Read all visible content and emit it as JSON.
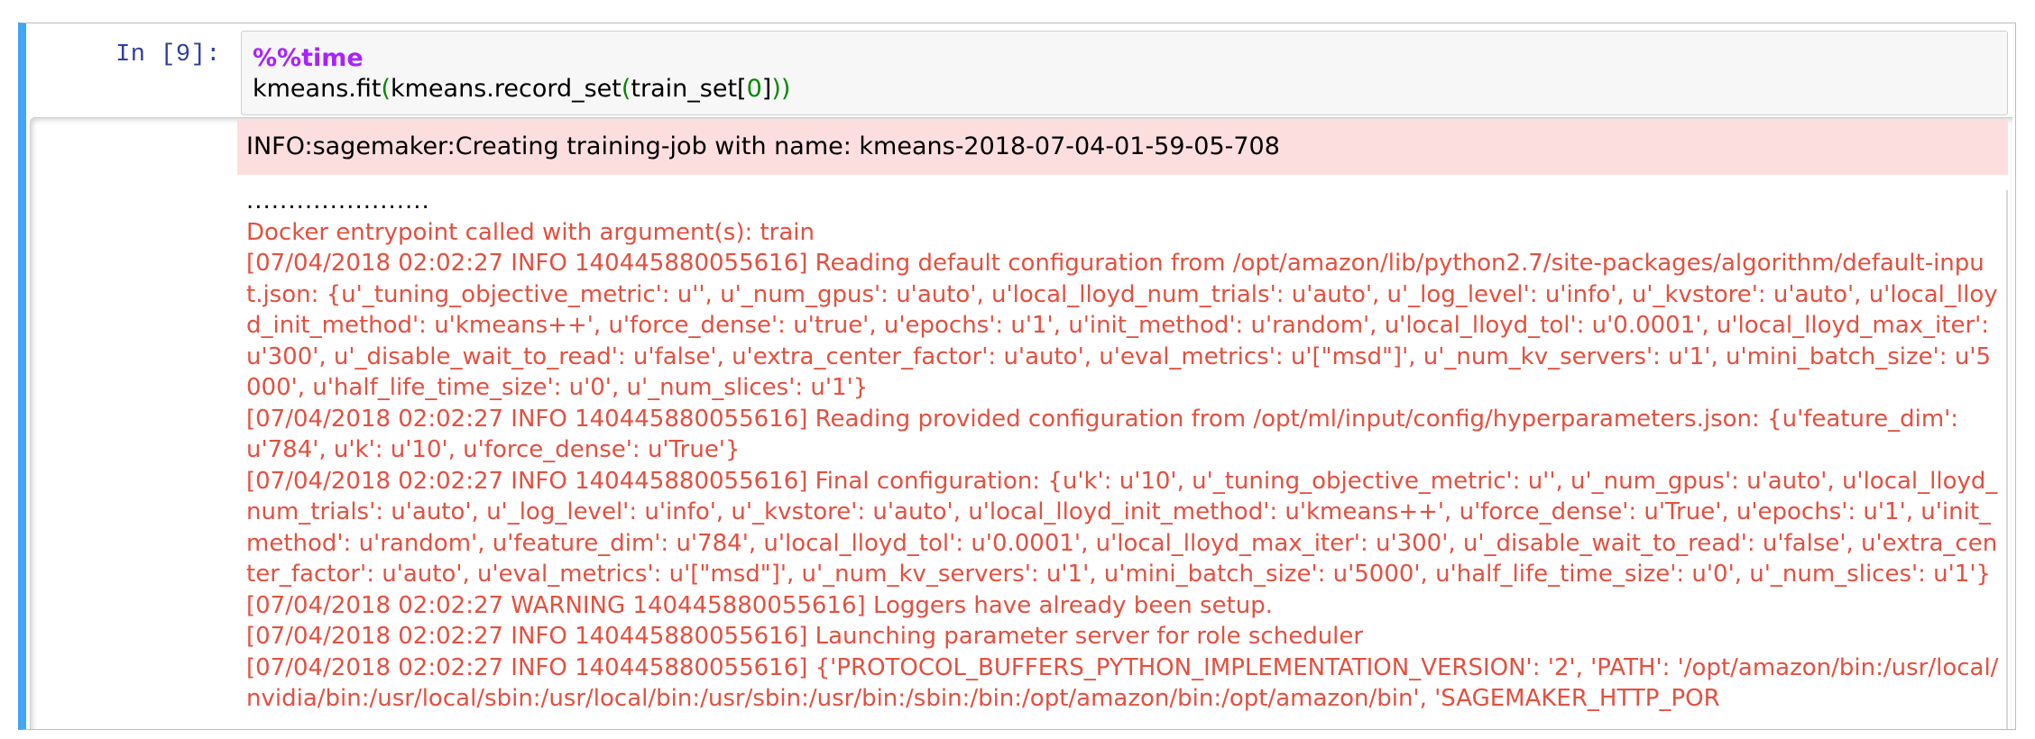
{
  "cell": {
    "prompt": "In [9]:",
    "code": {
      "magic": "%%time",
      "line2_pre": "kmeans.fit",
      "line2_open1": "(",
      "line2_mid": "kmeans.record_set",
      "line2_open2": "(",
      "line2_arg": "train_set[",
      "line2_num": "0",
      "line2_close_bracket": "]",
      "line2_close": "))"
    }
  },
  "output": {
    "info_message": "INFO:sagemaker:Creating training-job with name: kmeans-2018-07-04-01-59-05-708",
    "progress_dots": "......................",
    "log_lines": [
      "Docker entrypoint called with argument(s): train",
      "[07/04/2018 02:02:27 INFO 140445880055616] Reading default configuration from /opt/amazon/lib/python2.7/site-packages/algorithm/default-input.json: {u'_tuning_objective_metric': u'', u'_num_gpus': u'auto', u'local_lloyd_num_trials': u'auto', u'_log_level': u'info', u'_kvstore': u'auto', u'local_lloyd_init_method': u'kmeans++', u'force_dense': u'true', u'epochs': u'1', u'init_method': u'random', u'local_lloyd_tol': u'0.0001', u'local_lloyd_max_iter': u'300', u'_disable_wait_to_read': u'false', u'extra_center_factor': u'auto', u'eval_metrics': u'[\"msd\"]', u'_num_kv_servers': u'1', u'mini_batch_size': u'5000', u'half_life_time_size': u'0', u'_num_slices': u'1'}",
      "[07/04/2018 02:02:27 INFO 140445880055616] Reading provided configuration from /opt/ml/input/config/hyperparameters.json: {u'feature_dim': u'784', u'k': u'10', u'force_dense': u'True'}",
      "[07/04/2018 02:02:27 INFO 140445880055616] Final configuration: {u'k': u'10', u'_tuning_objective_metric': u'', u'_num_gpus': u'auto', u'local_lloyd_num_trials': u'auto', u'_log_level': u'info', u'_kvstore': u'auto', u'local_lloyd_init_method': u'kmeans++', u'force_dense': u'True', u'epochs': u'1', u'init_method': u'random', u'feature_dim': u'784', u'local_lloyd_tol': u'0.0001', u'local_lloyd_max_iter': u'300', u'_disable_wait_to_read': u'false', u'extra_center_factor': u'auto', u'eval_metrics': u'[\"msd\"]', u'_num_kv_servers': u'1', u'mini_batch_size': u'5000', u'half_life_time_size': u'0', u'_num_slices': u'1'}",
      "[07/04/2018 02:02:27 WARNING 140445880055616] Loggers have already been setup.",
      "[07/04/2018 02:02:27 INFO 140445880055616] Launching parameter server for role scheduler",
      "[07/04/2018 02:02:27 INFO 140445880055616] {'PROTOCOL_BUFFERS_PYTHON_IMPLEMENTATION_VERSION': '2', 'PATH': '/opt/amazon/bin:/usr/local/nvidia/bin:/usr/local/sbin:/usr/local/bin:/usr/sbin:/usr/bin:/sbin:/bin:/opt/amazon/bin:/opt/amazon/bin', 'SAGEMAKER_HTTP_POR"
    ]
  },
  "colors": {
    "cell_border_active": "#42a5f5",
    "prompt": "#303f9f",
    "stderr_background": "#fddede",
    "log_text": "#e35040",
    "magic": "#aa22ff",
    "paren": "#008800"
  }
}
